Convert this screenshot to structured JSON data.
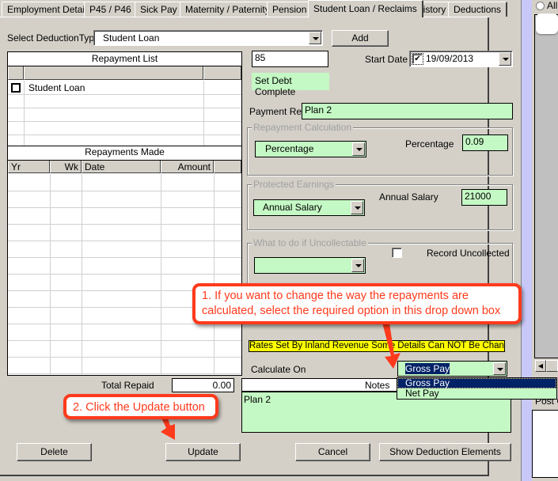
{
  "tabs": [
    {
      "label": "Employment Details",
      "active": false
    },
    {
      "label": "P45 / P46",
      "active": false
    },
    {
      "label": "Sick Pay",
      "active": false
    },
    {
      "label": "Maternity / Paternity",
      "active": false
    },
    {
      "label": "Pension",
      "active": false
    },
    {
      "label": "Student Loan / Reclaims",
      "active": true
    },
    {
      "label": "History",
      "active": false
    },
    {
      "label": "Deductions",
      "active": false
    }
  ],
  "deduction_type": {
    "label": "Select DeductionType",
    "value": "Student Loan",
    "add_label": "Add"
  },
  "repayment_list": {
    "title": "Repayment List",
    "rows": [
      {
        "checked": false,
        "name": "Student Loan"
      },
      {
        "checked": false,
        "name": ""
      },
      {
        "checked": false,
        "name": ""
      },
      {
        "checked": false,
        "name": ""
      },
      {
        "checked": false,
        "name": ""
      }
    ]
  },
  "repayments_made": {
    "title": "Repayments Made",
    "columns": [
      "Yr",
      "Wk",
      "Date",
      "Amount"
    ],
    "rows": [],
    "total_label": "Total Repaid",
    "total_value": "0.00"
  },
  "details": {
    "amount_value": "85",
    "start_date_label": "Start Date",
    "start_date_checked": true,
    "start_date_value": "19/09/2013",
    "set_debt_complete_label": "Set Debt Complete",
    "payment_ref_label": "Payment Ref",
    "payment_ref_value": "Plan 2"
  },
  "repayment_calculation": {
    "title": "Repayment Calculation",
    "method_value": "Percentage",
    "percentage_label": "Percentage",
    "percentage_value": "0.09"
  },
  "protected_earnings": {
    "title": "Protected Earnings",
    "method_value": "Annual Salary",
    "annual_salary_label": "Annual Salary",
    "annual_salary_value": "21000"
  },
  "uncollectable": {
    "title": "What to do if Uncollectable",
    "value": "",
    "record_uncollected_label": "Record Uncollected",
    "record_uncollected_checked": false
  },
  "warning_text": "Rates Set By Inland Revenue Some Details Can NOT Be Changed",
  "calculate_on": {
    "label": "Calculate On",
    "value": "Gross Pay",
    "options": [
      "Gross Pay",
      "Net Pay"
    ],
    "selected_index": 0
  },
  "notes": {
    "label": "Notes",
    "value": "Plan 2"
  },
  "buttons": {
    "delete": "Delete",
    "update": "Update",
    "cancel": "Cancel",
    "show_elements": "Show Deduction Elements"
  },
  "side_panel": {
    "radio_label": "All",
    "post_label": "Post C"
  },
  "callouts": {
    "step1": "1. If you want to change the way the repayments are calculated, select the required option in this drop down box",
    "step2": "2. Click the Update button"
  },
  "colors": {
    "field_green": "#c4f8c4",
    "warning_yellow": "#ffff00",
    "callout_red": "#ff3a1c",
    "selection_navy": "#002266"
  }
}
